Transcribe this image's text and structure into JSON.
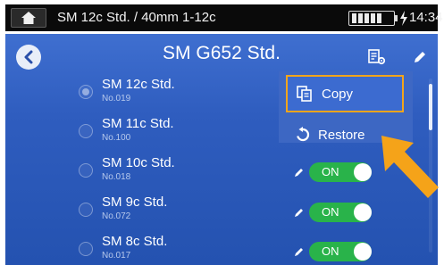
{
  "statusbar": {
    "title": "SM 12c Std. / 40mm 1-12c",
    "time": "14:34"
  },
  "header": {
    "title": "SM G652 Std."
  },
  "list": [
    {
      "name": "SM 12c Std.",
      "number": "No.019",
      "selected": true
    },
    {
      "name": "SM 11c Std.",
      "number": "No.100",
      "selected": false
    },
    {
      "name": "SM 10c Std.",
      "number": "No.018",
      "selected": false
    },
    {
      "name": "SM 9c Std.",
      "number": "No.072",
      "selected": false
    },
    {
      "name": "SM 8c Std.",
      "number": "No.017",
      "selected": false
    }
  ],
  "toggles": [
    {
      "label": "ON"
    },
    {
      "label": "ON"
    },
    {
      "label": "ON"
    }
  ],
  "menu": {
    "copy_label": "Copy",
    "restore_label": "Restore"
  },
  "colors": {
    "panel_blue": "#2f5dbf",
    "toggle_green": "#29b34a",
    "highlight_orange": "#f3a51b"
  },
  "icons": {
    "home": "home-icon",
    "battery": "battery-icon",
    "charging": "lightning-icon",
    "back": "chevron-left-icon",
    "settings": "list-settings-icon",
    "edit": "pencil-icon",
    "copy": "copy-icon",
    "restore": "restore-icon"
  }
}
